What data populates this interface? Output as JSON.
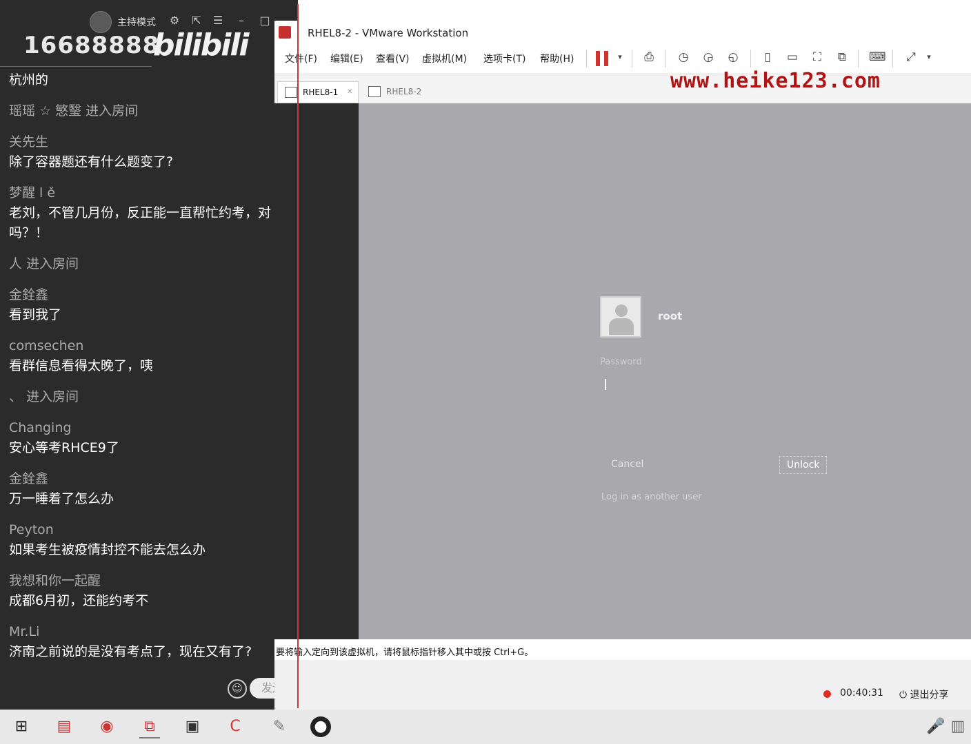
{
  "chat": {
    "host_mode": "主持模式",
    "room_number": "16688888",
    "logo_text": "bilibili",
    "messages": [
      {
        "kind": "text",
        "text": "杭州的"
      },
      {
        "kind": "sys",
        "text": "瑶瑶 ☆ 慜瑿 进入房间"
      },
      {
        "kind": "user",
        "user": "关先生",
        "text": "除了容器题还有什么题变了?"
      },
      {
        "kind": "user",
        "user": "梦醒 l ě",
        "text": "老刘，不管几月份，反正能一直帮忙约考，对",
        "text2": "吗？！"
      },
      {
        "kind": "sys",
        "text": "人 进入房间"
      },
      {
        "kind": "user",
        "user": "金銓鑫",
        "text": "看到我了"
      },
      {
        "kind": "user",
        "user": "comsechen",
        "text": "看群信息看得太晚了，咦"
      },
      {
        "kind": "sys",
        "text": "、 进入房间"
      },
      {
        "kind": "user",
        "user": "Changing",
        "text": "安心等考RHCE9了"
      },
      {
        "kind": "user",
        "user": "金銓鑫",
        "text": "万一睡着了怎么办"
      },
      {
        "kind": "user",
        "user": "Peyton",
        "text": "如果考生被疫情封控不能去怎么办"
      },
      {
        "kind": "user",
        "user": "我想和你一起醒",
        "text": "成都6月初，还能约考不"
      },
      {
        "kind": "user",
        "user": "Mr.Li",
        "text": "济南之前说的是没有考点了，现在又有了?"
      }
    ],
    "send_label": "发送"
  },
  "vmware": {
    "title": "RHEL8-2 - VMware Workstation",
    "menus": [
      "文件(F)",
      "编辑(E)",
      "查看(V)",
      "虚拟机(M)",
      "选项卡(T)",
      "帮助(H)"
    ],
    "watermark": "www.heike123.com",
    "tabs": [
      {
        "label": "RHEL8-1"
      },
      {
        "label": "RHEL8-2"
      }
    ],
    "status_text": "要将输入定向到该虚拟机，请将鼠标指针移入其中或按 Ctrl+G。",
    "lock": {
      "user": "root",
      "password_label": "Password",
      "cancel": "Cancel",
      "unlock": "Unlock",
      "switch_user": "Log in as another user"
    }
  },
  "share": {
    "time": "00:40:31",
    "exit_label": "退出分享"
  },
  "colors": {
    "chat_bg": "#2b2b2b",
    "guest_bg": "#a9a8ad",
    "accent_red": "#d0342c",
    "watermark": "#b01414"
  }
}
